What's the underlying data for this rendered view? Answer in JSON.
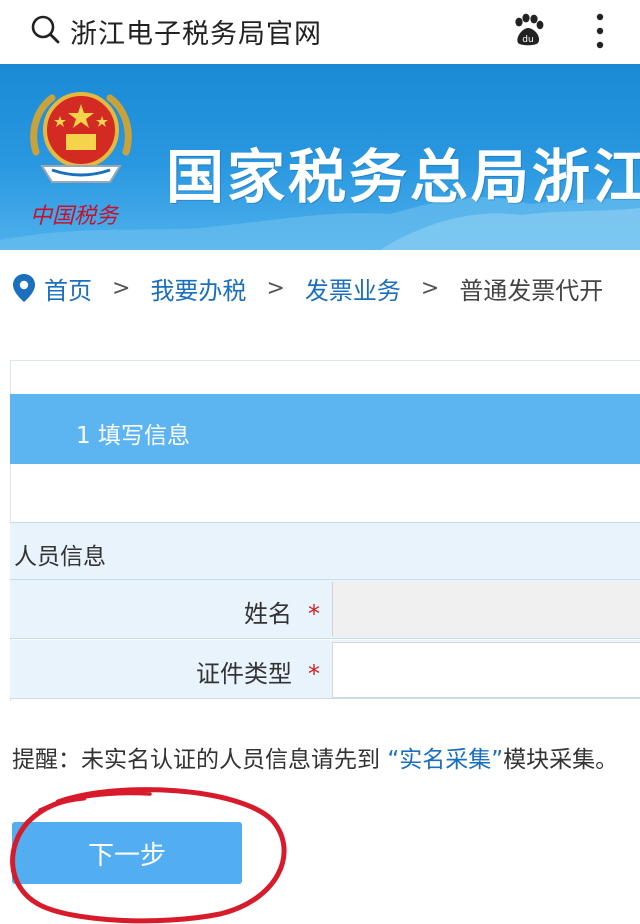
{
  "topbar": {
    "title": "浙江电子税务局官网",
    "icons": [
      "search-icon",
      "baidu-paw-icon",
      "more-vertical-icon"
    ]
  },
  "banner": {
    "title": "国家税务总局浙江省",
    "emblem_caption": "中国税务",
    "colors": {
      "background": "#2a98e0",
      "title": "#ffffff"
    }
  },
  "breadcrumb": {
    "items": [
      "首页",
      "我要办税",
      "发票业务"
    ],
    "separator": ">",
    "current": "普通发票代开"
  },
  "form": {
    "step_label": "1  填写信息",
    "section_title": "人员信息",
    "fields": [
      {
        "label": "姓名",
        "required_mark": "*",
        "value": ""
      },
      {
        "label": "证件类型",
        "required_mark": "*",
        "value": ""
      }
    ]
  },
  "notice": {
    "prefix": "提醒：未实名认证的人员信息请先到",
    "link": "“实名采集”",
    "suffix": "模块采集。"
  },
  "actions": {
    "next_label": "下一步"
  },
  "colors": {
    "accent": "#5cb5f0",
    "link": "#1a6fbf",
    "required": "#d21f1f",
    "annotation": "#d81b2b"
  }
}
